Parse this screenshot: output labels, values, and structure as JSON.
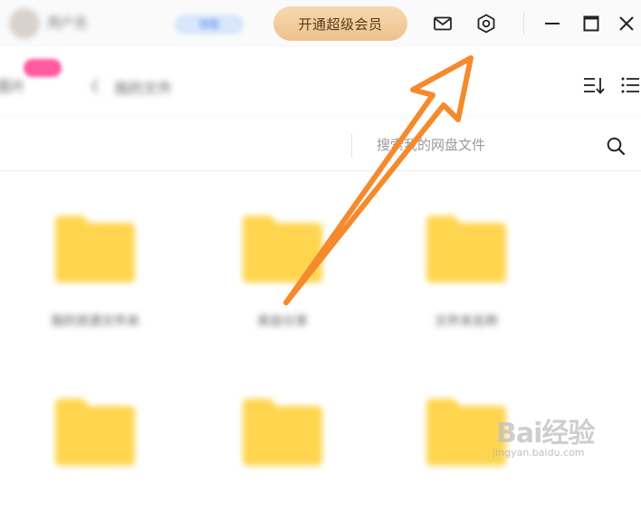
{
  "titlebar": {
    "user_name": "用户名",
    "blurred_button": "领取",
    "vip_button": "开通超级会员",
    "icons": [
      "mail-icon",
      "settings-icon",
      "minimize-icon",
      "maximize-icon",
      "close-icon"
    ]
  },
  "toolbar": {
    "left_tab": "图片",
    "badge_text": "",
    "nav_label": "我的文件",
    "sort_icon": "sort-icon",
    "list_icon": "list-view-icon"
  },
  "search": {
    "placeholder": "搜索我的网盘文件"
  },
  "folders": [
    {
      "name": "我的资源文件夹"
    },
    {
      "name": "来自分享"
    },
    {
      "name": "文件夹名称"
    },
    {
      "name": ""
    },
    {
      "name": ""
    },
    {
      "name": ""
    }
  ],
  "watermark": {
    "brand": "Bai经验",
    "url": "jingyan.baidu.com"
  },
  "colors": {
    "vip_gold": "#eec28e",
    "annotation_arrow": "#f58a2c",
    "folder_yellow": "#ffd54f"
  }
}
